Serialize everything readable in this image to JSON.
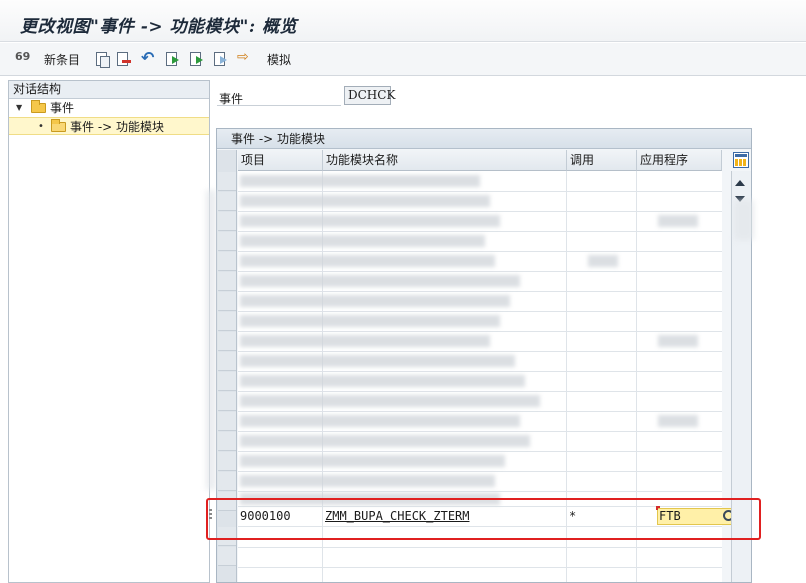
{
  "window": {
    "title": "更改视图\"事件 -> 功能模块\": 概览"
  },
  "toolbar": {
    "new_entries_label": "新条目",
    "simulate_label": "模拟",
    "icons": [
      "glasses-icon",
      "copy-icon",
      "delete-icon",
      "undo-icon",
      "select-all-icon",
      "select-block-icon",
      "deselect-all-icon",
      "transport-icon"
    ]
  },
  "dialog_structure": {
    "header": "对话结构",
    "items": [
      {
        "label": "事件",
        "level": 0,
        "expanded": true
      },
      {
        "label": "事件 -> 功能模块",
        "level": 1,
        "selected": true
      }
    ]
  },
  "event_field": {
    "label": "事件",
    "value": "DCHCK"
  },
  "table": {
    "caption": "事件 -> 功能模块",
    "columns": [
      "项目",
      "功能模块名称",
      "调用",
      "应用程序"
    ],
    "visible_row": {
      "item": "9000100",
      "function_module": "ZMM_BUPA_CHECK_ZTERM",
      "call": "*",
      "application": "FTB"
    }
  },
  "colors": {
    "selected_tree": "#fff7cc",
    "input_highlight": "#fff0a8",
    "annotation_red": "#e02020"
  }
}
